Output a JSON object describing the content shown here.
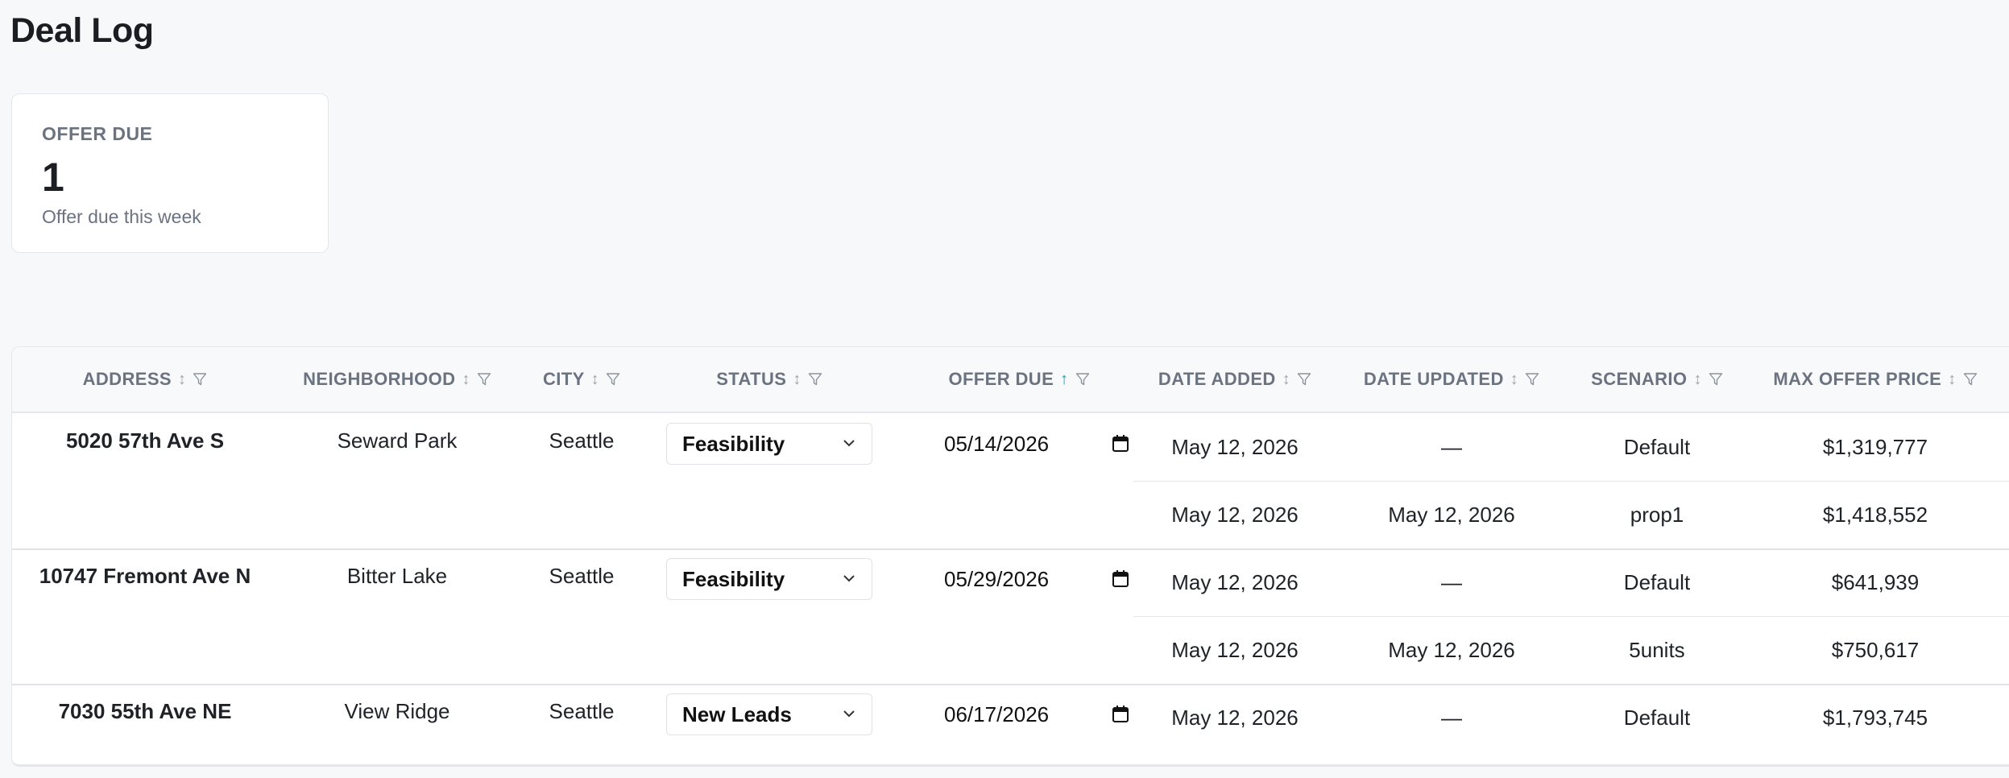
{
  "page": {
    "title": "Deal Log"
  },
  "stat_card": {
    "label": "OFFER DUE",
    "value": "1",
    "subtitle": "Offer due this week"
  },
  "table": {
    "columns": [
      {
        "label": "ADDRESS",
        "sort": "none"
      },
      {
        "label": "NEIGHBORHOOD",
        "sort": "none"
      },
      {
        "label": "CITY",
        "sort": "none"
      },
      {
        "label": "STATUS",
        "sort": "none"
      },
      {
        "label": "OFFER DUE",
        "sort": "ascending"
      },
      {
        "label": "DATE ADDED",
        "sort": "none"
      },
      {
        "label": "DATE UPDATED",
        "sort": "none"
      },
      {
        "label": "SCENARIO",
        "sort": "none"
      },
      {
        "label": "MAX OFFER PRICE",
        "sort": "none"
      }
    ],
    "sort_glyph": "↕",
    "sort_active_glyph": "↑",
    "deals": [
      {
        "address": "5020 57th Ave S",
        "neighborhood": "Seward Park",
        "city": "Seattle",
        "status": "Feasibility",
        "offer_due": "05/14/2026",
        "scenarios": [
          {
            "date_added": "May 12, 2026",
            "date_updated": "—",
            "scenario": "Default",
            "max_offer_price": "$1,319,777"
          },
          {
            "date_added": "May 12, 2026",
            "date_updated": "May 12, 2026",
            "scenario": "prop1",
            "max_offer_price": "$1,418,552"
          }
        ]
      },
      {
        "address": "10747 Fremont Ave N",
        "neighborhood": "Bitter Lake",
        "city": "Seattle",
        "status": "Feasibility",
        "offer_due": "05/29/2026",
        "scenarios": [
          {
            "date_added": "May 12, 2026",
            "date_updated": "—",
            "scenario": "Default",
            "max_offer_price": "$641,939"
          },
          {
            "date_added": "May 12, 2026",
            "date_updated": "May 12, 2026",
            "scenario": "5units",
            "max_offer_price": "$750,617"
          }
        ]
      },
      {
        "address": "7030 55th Ave NE",
        "neighborhood": "View Ridge",
        "city": "Seattle",
        "status": "New Leads",
        "offer_due": "06/17/2026",
        "scenarios": [
          {
            "date_added": "May 12, 2026",
            "date_updated": "—",
            "scenario": "Default",
            "max_offer_price": "$1,793,745"
          }
        ]
      }
    ]
  },
  "colors": {
    "accent": "#14a3a8",
    "muted": "#6b7280",
    "border": "#e3e6ea",
    "background": "#f7f8fa"
  },
  "icons": {
    "sort": "sort-icon",
    "filter": "filter-icon",
    "chevron": "chevron-down-icon",
    "calendar": "calendar-icon"
  }
}
